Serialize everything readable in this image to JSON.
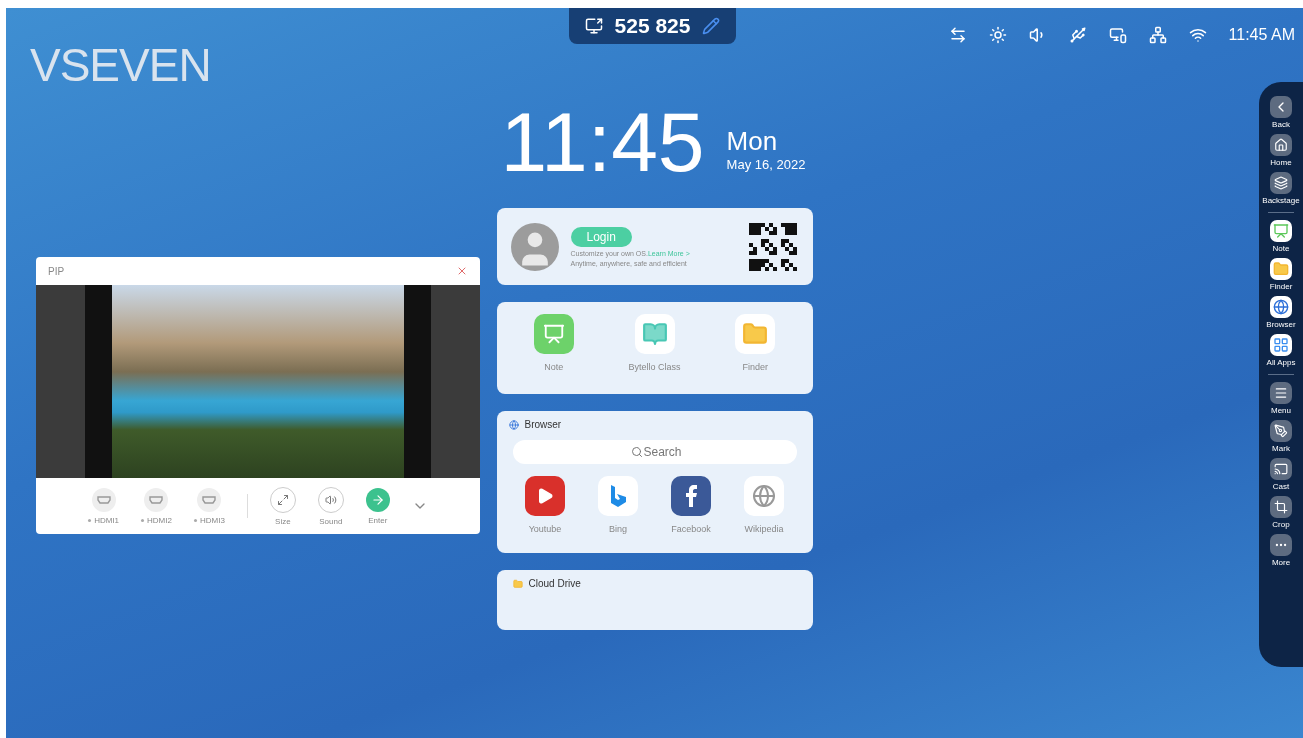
{
  "logo": "VSEVEN",
  "top_code": {
    "code": "525 825"
  },
  "status_bar": {
    "time": "11:45 AM"
  },
  "clock": {
    "time": "11:45",
    "weekday": "Mon",
    "date": "May 16, 2022"
  },
  "account_card": {
    "login_button": "Login",
    "line_1": "Customize your own OS.",
    "learn_more": "Learn More >",
    "line_2": "Anytime, anywhere, safe and efficient"
  },
  "apps_card": {
    "apps": [
      {
        "kind": "note",
        "label": "Note"
      },
      {
        "kind": "class",
        "label": "Bytello Class"
      },
      {
        "kind": "finder",
        "label": "Finder"
      }
    ]
  },
  "browser_card": {
    "title": "Browser",
    "search": {
      "placeholder": "Search"
    },
    "shortcuts": [
      {
        "kind": "youtube",
        "label": "Youtube"
      },
      {
        "kind": "bing",
        "label": "Bing"
      },
      {
        "kind": "facebook",
        "label": "Facebook"
      },
      {
        "kind": "wikipedia",
        "label": "Wikipedia"
      }
    ]
  },
  "cloud_card": {
    "title": "Cloud Drive"
  },
  "pip_window": {
    "title": "PIP",
    "sources": [
      {
        "label": "HDMI1"
      },
      {
        "label": "HDMI2"
      },
      {
        "label": "HDMI3"
      }
    ],
    "actions": [
      {
        "kind": "size",
        "label": "Size"
      },
      {
        "kind": "sound",
        "label": "Sound"
      },
      {
        "kind": "enter",
        "label": "Enter"
      }
    ]
  },
  "dock": {
    "groups": [
      [
        {
          "kind": "back",
          "label": "Back"
        },
        {
          "kind": "home",
          "label": "Home"
        },
        {
          "kind": "backstage",
          "label": "Backstage"
        }
      ],
      [
        {
          "kind": "note",
          "label": "Note"
        },
        {
          "kind": "finder",
          "label": "Finder"
        },
        {
          "kind": "browser",
          "label": "Browser"
        },
        {
          "kind": "allapps",
          "label": "All Apps"
        }
      ],
      [
        {
          "kind": "menu",
          "label": "Menu"
        },
        {
          "kind": "mark",
          "label": "Mark"
        },
        {
          "kind": "cast",
          "label": "Cast"
        },
        {
          "kind": "crop",
          "label": "Crop"
        },
        {
          "kind": "more",
          "label": "More"
        }
      ]
    ]
  }
}
